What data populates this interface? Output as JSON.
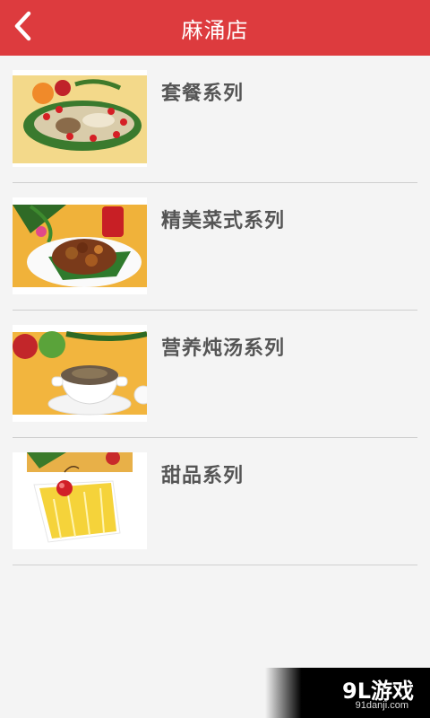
{
  "header": {
    "title": "麻涌店",
    "back_icon": "chevron-left-icon"
  },
  "menu": {
    "items": [
      {
        "label": "套餐系列"
      },
      {
        "label": "精美菜式系列"
      },
      {
        "label": "营养炖汤系列"
      },
      {
        "label": "甜品系列"
      }
    ]
  },
  "watermark": {
    "brand": "9L游戏",
    "site": "91danji.com"
  },
  "colors": {
    "header_bg": "#dd3b3e",
    "background": "#f4f4f4",
    "divider": "#cfcfcf",
    "label_text": "#555555"
  }
}
